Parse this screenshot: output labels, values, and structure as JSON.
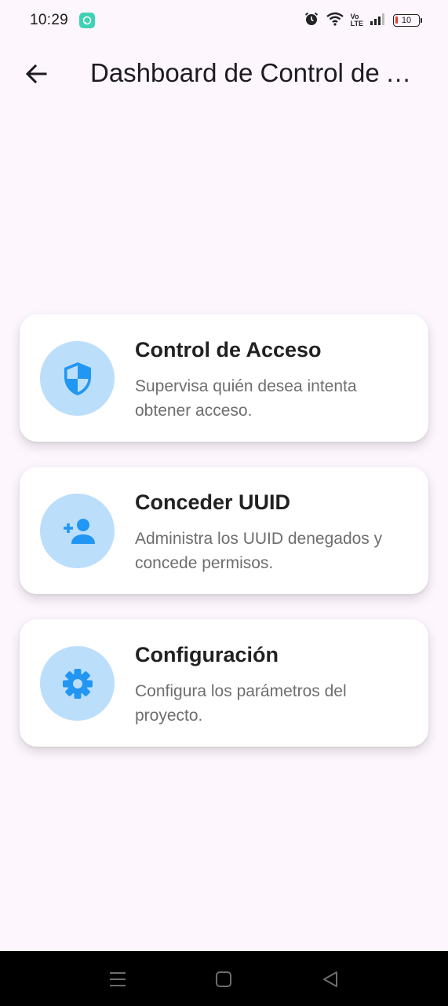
{
  "status_bar": {
    "time": "10:29",
    "volte_top": "Vo",
    "volte_bottom": "LTE",
    "battery": "10"
  },
  "app_bar": {
    "title": "Dashboard de Control de Acceso"
  },
  "cards": [
    {
      "title": "Control de Acceso",
      "description": "Supervisa quién desea intenta obtener acceso.",
      "icon": "shield-icon"
    },
    {
      "title": "Conceder UUID",
      "description": "Administra los UUID denegados y concede permisos.",
      "icon": "person-add-icon"
    },
    {
      "title": "Configuración",
      "description": "Configura los parámetros del proyecto.",
      "icon": "gear-icon"
    }
  ],
  "colors": {
    "background": "#fdf6fd",
    "icon_circle": "#bbdefb",
    "icon_fill": "#2196f3",
    "card": "#ffffff",
    "nav_bar": "#000000"
  }
}
